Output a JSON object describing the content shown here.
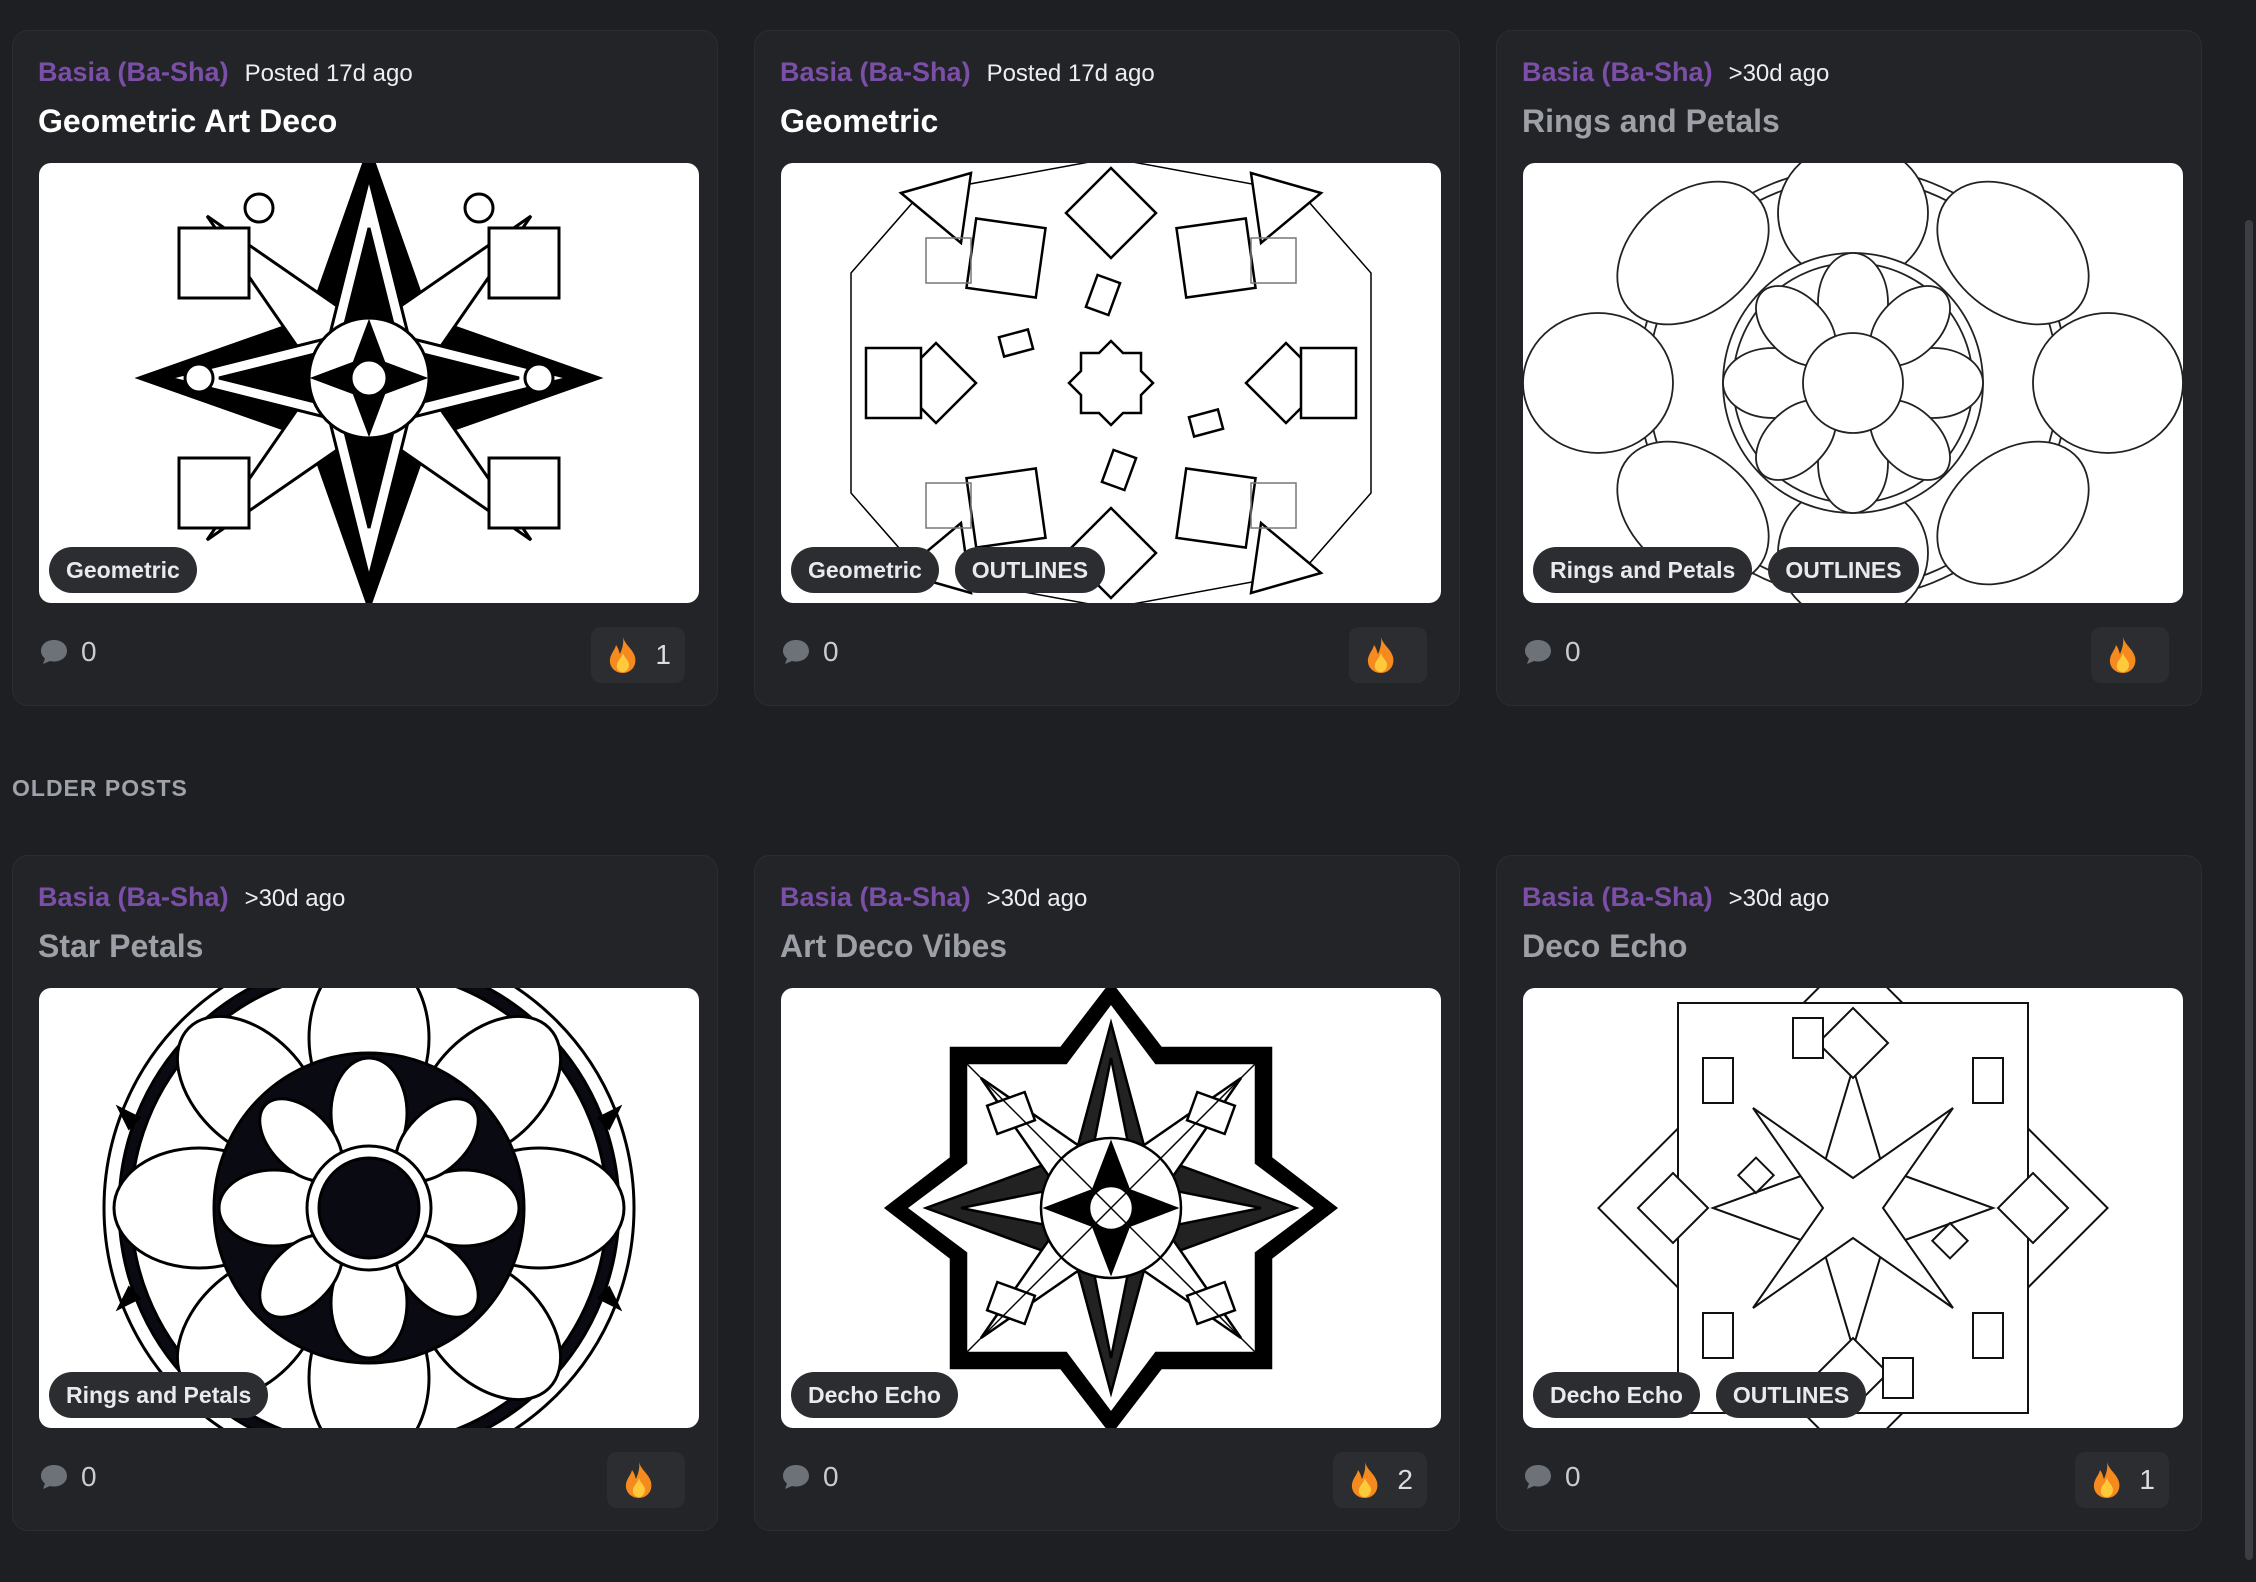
{
  "section_older_label": "OLDER POSTS",
  "posts": [
    {
      "author": "Basia (Ba-Sha)",
      "time": "Posted 17d ago",
      "title": "Geometric Art Deco",
      "tags": [
        "Geometric"
      ],
      "comments": "0",
      "reaction_icon": "fire-icon",
      "reaction_count": "1"
    },
    {
      "author": "Basia (Ba-Sha)",
      "time": "Posted 17d ago",
      "title": "Geometric",
      "tags": [
        "Geometric",
        "OUTLINES"
      ],
      "comments": "0",
      "reaction_icon": "fire-icon",
      "reaction_count": ""
    },
    {
      "author": "Basia (Ba-Sha)",
      "time": ">30d ago",
      "title": "Rings and Petals",
      "tags": [
        "Rings and Petals",
        "OUTLINES"
      ],
      "comments": "0",
      "reaction_icon": "fire-icon",
      "reaction_count": ""
    },
    {
      "author": "Basia (Ba-Sha)",
      "time": ">30d ago",
      "title": "Star Petals",
      "tags": [
        "Rings and Petals"
      ],
      "comments": "0",
      "reaction_icon": "fire-icon",
      "reaction_count": ""
    },
    {
      "author": "Basia (Ba-Sha)",
      "time": ">30d ago",
      "title": "Art Deco Vibes",
      "tags": [
        "Decho Echo"
      ],
      "comments": "0",
      "reaction_icon": "fire-icon",
      "reaction_count": "2"
    },
    {
      "author": "Basia (Ba-Sha)",
      "time": ">30d ago",
      "title": "Deco Echo",
      "tags": [
        "Decho Echo",
        "OUTLINES"
      ],
      "comments": "0",
      "reaction_icon": "fire-icon",
      "reaction_count": "1"
    }
  ],
  "colors": {
    "background": "#1e1f23",
    "card": "#232428",
    "author": "#7b4fa8",
    "tag": "#2b2d31"
  }
}
